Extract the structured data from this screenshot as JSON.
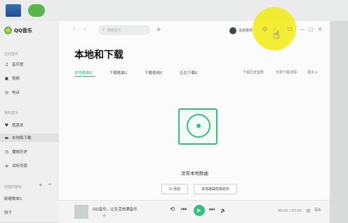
{
  "desktop": {
    "icons": [
      "computer-icon",
      "wechat-icon"
    ]
  },
  "app": {
    "name": "QQ音乐",
    "brand_color": "#31c27c"
  },
  "sidebar": {
    "section_online": "在线音乐",
    "online_items": [
      {
        "icon": "music-note-icon",
        "label": "音乐馆"
      },
      {
        "icon": "video-icon",
        "label": "视频"
      },
      {
        "icon": "radio-icon",
        "label": "电台"
      }
    ],
    "section_mine": "我的音乐",
    "mine_items": [
      {
        "icon": "heart-icon",
        "label": "我喜欢"
      },
      {
        "icon": "monitor-download-icon",
        "label": "本地和下载"
      },
      {
        "icon": "clock-icon",
        "label": "播放历史"
      },
      {
        "icon": "list-icon",
        "label": "试听列表"
      }
    ],
    "section_playlists": "创建的歌单",
    "playlist_items": [
      {
        "label": "新建歌单1"
      },
      {
        "label": "饼子"
      }
    ],
    "plus": "+",
    "collapse": "^"
  },
  "header": {
    "back": "‹",
    "forward": "›",
    "search_placeholder": "搜索音乐",
    "mic": "◉",
    "username": "谈来雅意",
    "icons": [
      "☺",
      "♢",
      "☐",
      "—",
      "□",
      "✕"
    ]
  },
  "page": {
    "title": "本地和下载",
    "tabs": [
      "本地歌曲0",
      "下载歌曲1",
      "下载视频0",
      "正在下载0"
    ],
    "right_actions": [
      "下载历史音质",
      "付费下载详情",
      "更多 ▾"
    ],
    "empty_text": "没有本地歌曲",
    "buttons": [
      "⊡ 添加",
      "本地歌曲恢复助手"
    ]
  },
  "player": {
    "song": "QQ音乐，让生活充满音乐",
    "sub_icons": [
      "♡",
      "⊕",
      "⋯"
    ],
    "controls": [
      "⟲",
      "⏮",
      "▶",
      "⏭",
      "🔈"
    ],
    "time": "00:00 / 00:00",
    "right": [
      "词",
      "☰4"
    ]
  }
}
